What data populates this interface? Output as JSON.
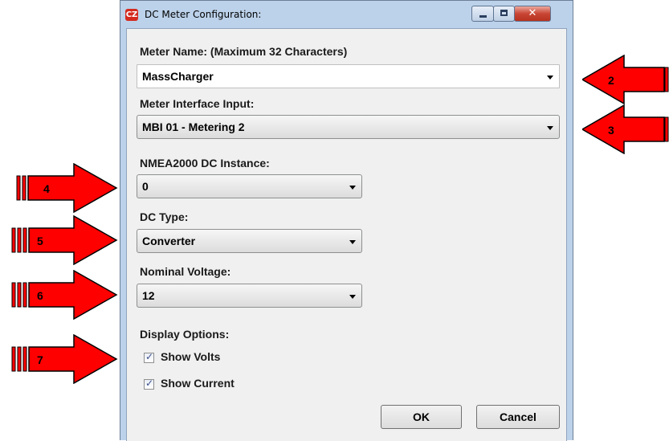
{
  "window": {
    "title": "DC Meter Configuration:",
    "icon": "CZ"
  },
  "fields": {
    "meter_name_label": "Meter Name: (Maximum 32 Characters)",
    "meter_name_value": "MassCharger",
    "interface_label": "Meter Interface Input:",
    "interface_value": "MBI 01 - Metering 2",
    "instance_label": "NMEA2000 DC Instance:",
    "instance_value": "0",
    "dc_type_label": "DC Type:",
    "dc_type_value": "Converter",
    "voltage_label": "Nominal Voltage:",
    "voltage_value": "12",
    "display_options_label": "Display Options:",
    "show_volts_label": "Show Volts",
    "show_volts_checked": true,
    "show_current_label": "Show Current",
    "show_current_checked": true
  },
  "buttons": {
    "ok": "OK",
    "cancel": "Cancel"
  },
  "annotations": [
    "2",
    "3",
    "4",
    "5",
    "6",
    "7"
  ],
  "colors": {
    "arrow_fill": "#ff0000",
    "window_frame": "#bcd2ea",
    "dialog_bg": "#f0f0f0"
  }
}
